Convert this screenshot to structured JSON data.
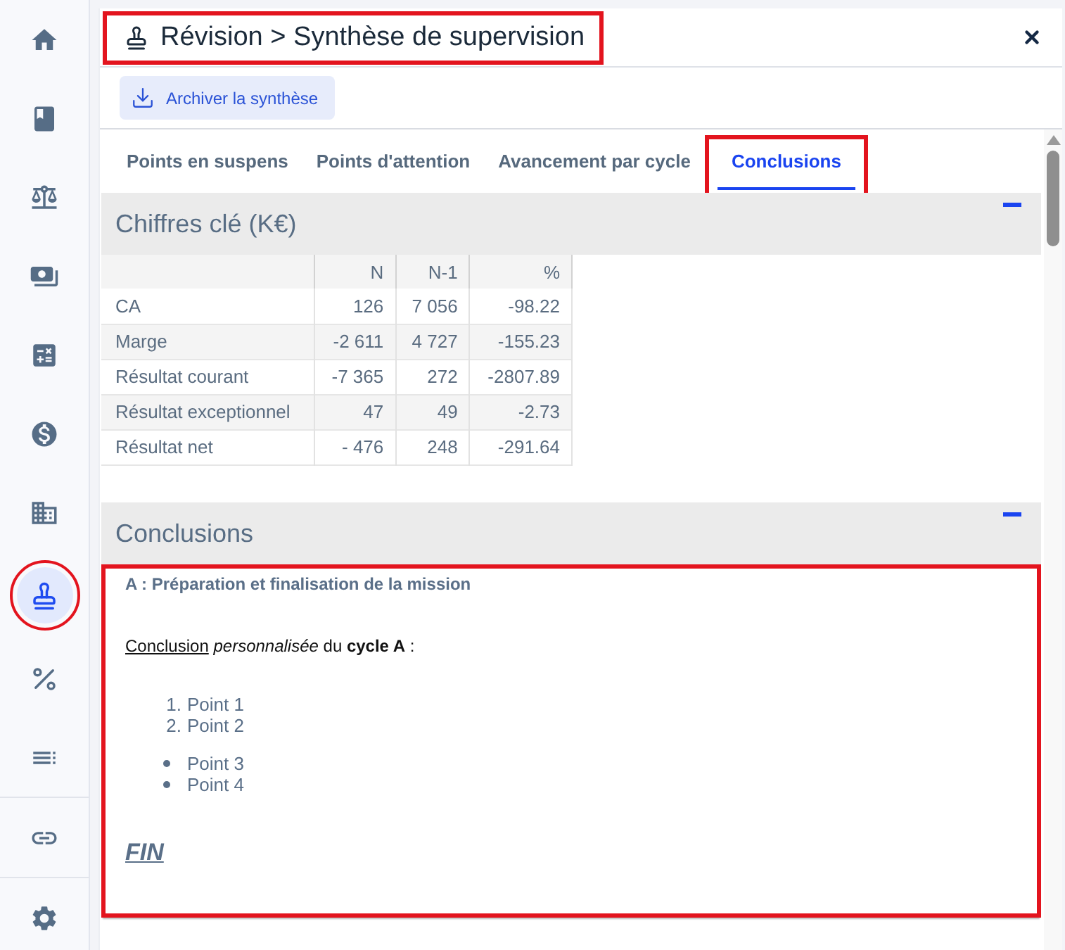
{
  "sidebar": {
    "sections": [
      {
        "items": [
          {
            "kind": "home",
            "selected": false,
            "highlighted": false
          },
          {
            "kind": "book",
            "selected": false,
            "highlighted": false
          },
          {
            "kind": "scales",
            "selected": false,
            "highlighted": false
          },
          {
            "kind": "cash",
            "selected": false,
            "highlighted": false
          },
          {
            "kind": "calculator",
            "selected": false,
            "highlighted": false
          },
          {
            "kind": "dollar",
            "selected": false,
            "highlighted": false
          },
          {
            "kind": "building",
            "selected": false,
            "highlighted": false
          },
          {
            "kind": "stamp",
            "selected": true,
            "highlighted": true
          },
          {
            "kind": "percent",
            "selected": false,
            "highlighted": false
          },
          {
            "kind": "list",
            "selected": false,
            "highlighted": false
          }
        ]
      },
      {
        "items": [
          {
            "kind": "link",
            "selected": false,
            "highlighted": false
          }
        ]
      },
      {
        "items": [
          {
            "kind": "settings",
            "selected": false,
            "highlighted": false
          }
        ]
      }
    ]
  },
  "header": {
    "title": "Révision > Synthèse de supervision",
    "highlighted": true
  },
  "toolbar": {
    "buttons": [
      {
        "label": "Archiver la synthèse"
      }
    ]
  },
  "tabs": [
    {
      "label": "Points en suspens",
      "selected": false,
      "highlighted": false
    },
    {
      "label": "Points d'attention",
      "selected": false,
      "highlighted": false
    },
    {
      "label": "Avancement par cycle",
      "selected": false,
      "highlighted": false
    },
    {
      "label": "Conclusions",
      "selected": true,
      "highlighted": true
    }
  ],
  "sections": [
    {
      "kind": "table",
      "title": "Chiffres clé (K€)",
      "expanded": true,
      "highlighted": false,
      "table": {
        "columns": [
          "N",
          "N-1",
          "%"
        ],
        "rows": [
          {
            "label": "CA",
            "cells": [
              "126",
              "7 056",
              "-98.22"
            ]
          },
          {
            "label": "Marge",
            "cells": [
              "-2 611",
              "4 727",
              "-155.23"
            ]
          },
          {
            "label": "Résultat courant",
            "cells": [
              "-7 365",
              "272",
              "-2807.89"
            ]
          },
          {
            "label": "Résultat exceptionnel",
            "cells": [
              "47",
              "49",
              "-2.73"
            ]
          },
          {
            "label": "Résultat net",
            "cells": [
              "- 476",
              "248",
              "-291.64"
            ]
          }
        ]
      }
    },
    {
      "kind": "text",
      "title": "Conclusions",
      "expanded": true,
      "highlighted": true,
      "content": {
        "heading": "A : Préparation et finalisation de la mission",
        "paragraph": {
          "lead": "Conclusion",
          "rest": " *personnalisée* du **cycle A** :"
        },
        "lists": [
          {
            "kind": "ordered",
            "items": [
              {
                "marker": "1.",
                "text": "Point 1"
              },
              {
                "marker": "2.",
                "text": "Point 2"
              }
            ]
          },
          {
            "kind": "bullet",
            "items": [
              {
                "text": "Point 3"
              },
              {
                "text": "Point 4"
              }
            ]
          }
        ],
        "closing": "FIN"
      }
    }
  ]
}
